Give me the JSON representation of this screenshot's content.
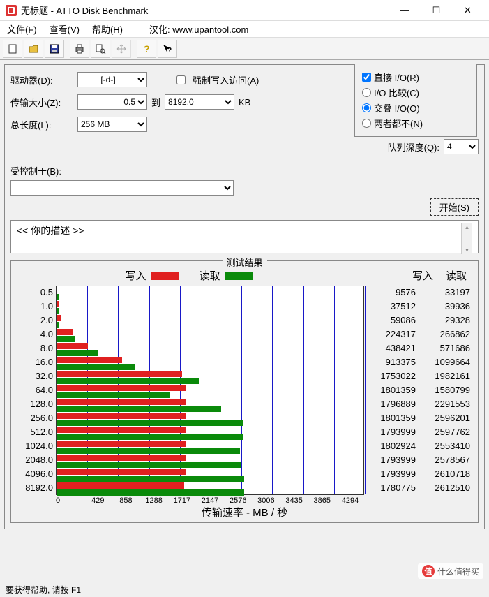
{
  "window": {
    "title": "无标题 - ATTO Disk Benchmark",
    "min": "—",
    "max": "☐",
    "close": "✕"
  },
  "menu": {
    "file": "文件(F)",
    "view": "查看(V)",
    "help": "帮助(H)",
    "localized": "汉化: www.upantool.com"
  },
  "config": {
    "drive_label": "驱动器(D):",
    "drive_value": "[-d-]",
    "force_write_label": "强制写入访问(A)",
    "direct_io_label": "直接 I/O(R)",
    "transfer_label": "传输大小(Z):",
    "transfer_from": "0.5",
    "transfer_to_label": "到",
    "transfer_to": "8192.0",
    "transfer_unit": "KB",
    "total_len_label": "总长度(L):",
    "total_len_value": "256 MB",
    "io_compare": "I/O 比较(C)",
    "io_overlap": "交叠 I/O(O)",
    "io_neither": "两者都不(N)",
    "queue_label": "队列深度(Q):",
    "queue_value": "4",
    "controlled_label": "受控制于(B):",
    "controlled_value": "",
    "start_btn": "开始(S)",
    "desc_text": "<<  你的描述    >>"
  },
  "results": {
    "title": "测试结果",
    "legend_write": "写入",
    "legend_read": "读取",
    "col_write": "写入",
    "col_read": "读取",
    "xaxis_label": "传输速率 - MB / 秒",
    "xticks": [
      "0",
      "429",
      "858",
      "1288",
      "1717",
      "2147",
      "2576",
      "3006",
      "3435",
      "3865",
      "4294"
    ]
  },
  "chart_data": {
    "type": "bar",
    "orientation": "horizontal",
    "categories": [
      "0.5",
      "1.0",
      "2.0",
      "4.0",
      "8.0",
      "16.0",
      "32.0",
      "64.0",
      "128.0",
      "256.0",
      "512.0",
      "1024.0",
      "2048.0",
      "4096.0",
      "8192.0"
    ],
    "unit_category": "KB (transfer size)",
    "unit_value": "KB/s",
    "series": [
      {
        "name": "写入",
        "color": "#e02020",
        "values": [
          9576,
          37512,
          59086,
          224317,
          438421,
          913375,
          1753022,
          1801359,
          1796889,
          1801359,
          1793999,
          1802924,
          1793999,
          1793999,
          1780775
        ]
      },
      {
        "name": "读取",
        "color": "#0a8a0a",
        "values": [
          33197,
          39936,
          29328,
          266862,
          571686,
          1099664,
          1982161,
          1580799,
          2291553,
          2596201,
          2597762,
          2553410,
          2578567,
          2610718,
          2612510
        ]
      }
    ],
    "xlim": [
      0,
      4294000
    ],
    "xticks_display": [
      0,
      429,
      858,
      1288,
      1717,
      2147,
      2576,
      3006,
      3435,
      3865,
      4294
    ],
    "xlabel": "传输速率 - MB / 秒",
    "ylabel": ""
  },
  "status": {
    "text": "要获得帮助, 请按 F1"
  },
  "watermark": {
    "text": "什么值得买"
  }
}
